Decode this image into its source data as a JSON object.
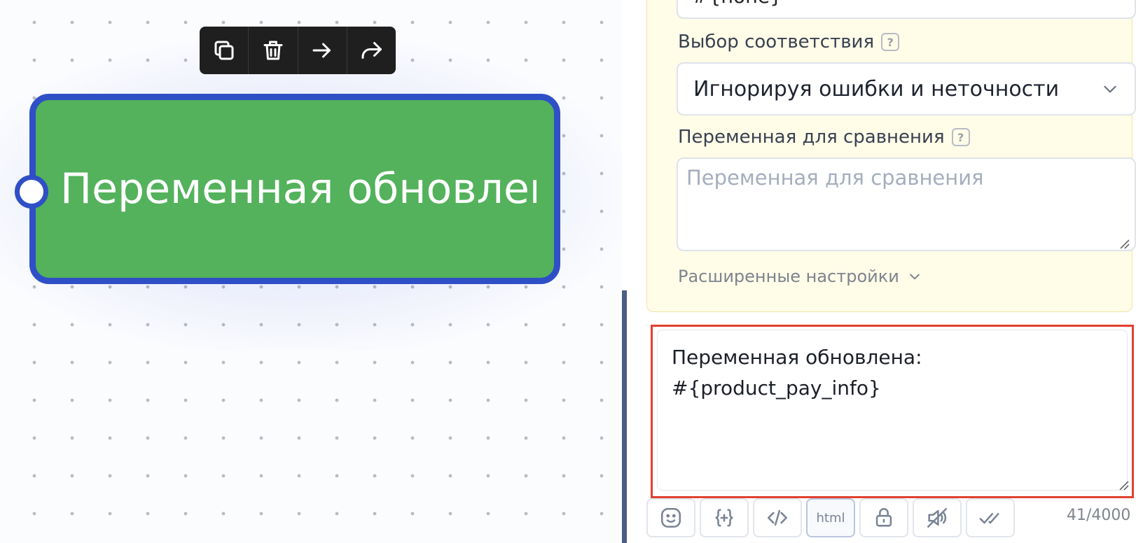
{
  "canvas": {
    "node": {
      "title": "Переменная обновлен",
      "color": "#53b25b",
      "border_color": "#2f4fc6"
    },
    "toolbar": {
      "icons": [
        "copy-icon",
        "trash-icon",
        "arrow-right-icon",
        "share-icon"
      ]
    }
  },
  "panel": {
    "top_value": "#{none}",
    "match_label": "Выбор соответствия",
    "match_value": "Игнорируя ошибки и неточности",
    "compare_label": "Переменная для сравнения",
    "compare_placeholder": "Переменная для сравнения",
    "help_glyph": "?",
    "advanced_label": "Расширенные настройки"
  },
  "message": {
    "line1": "Переменная обновлена:",
    "line2": "#{product_pay_info}",
    "highlight_color": "#e0412f",
    "toolbar": {
      "html_label": "html",
      "icons": [
        "emoji-icon",
        "insert-variable-icon",
        "code-icon",
        "html-icon",
        "lock-icon",
        "mute-icon",
        "double-check-icon"
      ]
    },
    "counter": "41/4000"
  }
}
